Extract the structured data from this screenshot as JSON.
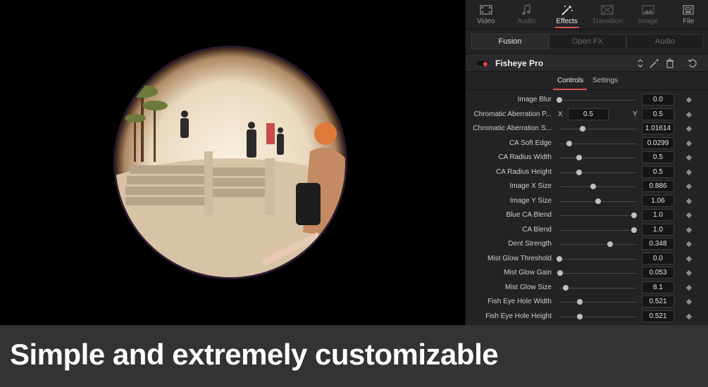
{
  "viewer": {
    "image_description": "fisheye",
    "colors": {
      "background": "#000000",
      "sky": "#efe4d2",
      "vignette_edge": "#2b1a14"
    }
  },
  "inspector": {
    "top_tabs": [
      {
        "label": "Video",
        "icon": "film-icon",
        "state": "normal"
      },
      {
        "label": "Audio",
        "icon": "music-note-icon",
        "state": "dim"
      },
      {
        "label": "Effects",
        "icon": "magic-wand-icon",
        "state": "active"
      },
      {
        "label": "Transition",
        "icon": "transition-icon",
        "state": "dim"
      },
      {
        "label": "Image",
        "icon": "image-icon",
        "state": "dim"
      },
      {
        "label": "File",
        "icon": "file-cabinet-icon",
        "state": "normal"
      }
    ],
    "sub_tabs": [
      {
        "label": "Fusion",
        "state": "active"
      },
      {
        "label": "Open FX",
        "state": "dim"
      },
      {
        "label": "Audio",
        "state": "dim"
      }
    ],
    "effect": {
      "name": "Fisheye Pro",
      "enabled": true,
      "accent_color": "#e24a3b"
    },
    "control_tabs": [
      {
        "label": "Controls",
        "state": "active"
      },
      {
        "label": "Settings",
        "state": "normal"
      }
    ],
    "params": [
      {
        "label": "Image Blur",
        "value": "0.0",
        "level": 0.0
      },
      {
        "label": "Chromatic Aberration P...",
        "type": "xy",
        "x_label": "X",
        "x_value": "0.5",
        "y_label": "Y",
        "y_value": "0.5"
      },
      {
        "label": "Chromatic Aberration S...",
        "value": "1.01614",
        "level": 0.3
      },
      {
        "label": "CA Soft Edge",
        "value": "0.0299",
        "level": 0.13
      },
      {
        "label": "CA Radius Width",
        "value": "0.5",
        "level": 0.25
      },
      {
        "label": "CA Radius Height",
        "value": "0.5",
        "level": 0.25
      },
      {
        "label": "Image X Size",
        "value": "0.886",
        "level": 0.44
      },
      {
        "label": "Image Y Size",
        "value": "1.06",
        "level": 0.5
      },
      {
        "label": "Blue CA Blend",
        "value": "1.0",
        "level": 0.96
      },
      {
        "label": "CA Blend",
        "value": "1.0",
        "level": 0.96
      },
      {
        "label": "Dent Strength",
        "value": "0.348",
        "level": 0.65
      },
      {
        "label": "Mist Glow Threshold",
        "value": "0.0",
        "level": 0.0
      },
      {
        "label": "Mist Glow Gain",
        "value": "0.053",
        "level": 0.01
      },
      {
        "label": "Mist Glow Size",
        "value": "8.1",
        "level": 0.08
      },
      {
        "label": "Fish Eye Hole Width",
        "value": "0.521",
        "level": 0.26
      },
      {
        "label": "Fish Eye Hole Height",
        "value": "0.521",
        "level": 0.26
      }
    ]
  },
  "caption": {
    "text": "Simple and extremely customizable",
    "background": "#333336",
    "color": "#ffffff"
  }
}
